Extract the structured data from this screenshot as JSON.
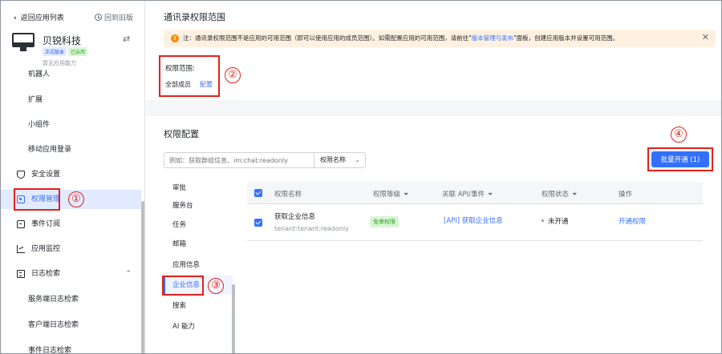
{
  "sidebar": {
    "back_label": "返回应用列表",
    "old_version_label": "回到旧版",
    "app_name": "贝锐科技",
    "badges": [
      "正式版本",
      "已启用"
    ],
    "ability_text": "暂无应用能力",
    "cut_item": "机器人",
    "items": [
      {
        "label": "扩展",
        "level": "sub"
      },
      {
        "label": "小组件",
        "level": "sub"
      },
      {
        "label": "移动应用登录",
        "level": "sub"
      },
      {
        "label": "安全设置",
        "level": "top",
        "icon": "shield-icon"
      },
      {
        "label": "权限管理",
        "level": "top",
        "icon": "key-icon",
        "active": true
      },
      {
        "label": "事件订阅",
        "level": "top",
        "icon": "event-icon"
      },
      {
        "label": "应用监控",
        "level": "top",
        "icon": "chart-icon"
      },
      {
        "label": "日志检索",
        "level": "top",
        "icon": "log-icon",
        "expanded": true
      },
      {
        "label": "服务端日志检索",
        "level": "sub"
      },
      {
        "label": "客户端日志检索",
        "level": "sub"
      },
      {
        "label": "事件日志检索",
        "level": "sub"
      }
    ]
  },
  "scope_section": {
    "title": "通讯录权限范围",
    "notice_prefix": "注：通讯录权限范围不是应用的可用范围（即可以使用应用的成员范围）。如需配置应用的可用范围，请前往\"",
    "notice_link": "版本管理与发布",
    "notice_suffix": "\"面板，创建应用版本并设置可用范围。",
    "scope_label": "权限范围:",
    "scope_value": "全部成员",
    "configure_label": "配置"
  },
  "permission_section": {
    "title": "权限配置",
    "search_placeholder": "例如：获取群组信息、im:chat:readonly",
    "select_value": "权限名称",
    "batch_button": "批量开通 (1)",
    "categories": [
      "审批",
      "服务台",
      "任务",
      "邮箱",
      "应用信息",
      "企业信息",
      "搜索",
      "AI 能力"
    ],
    "active_category": 5,
    "table": {
      "headers": [
        "权限名称",
        "权限等级",
        "关联 API/事件",
        "权限状态",
        "操作"
      ],
      "rows": [
        {
          "name": "获取企业信息",
          "code": "tenant:tenant:readonly",
          "level": "免审权限",
          "api": "[API] 获取企业信息",
          "status": "未开通",
          "action": "开通权限"
        }
      ]
    }
  },
  "annotations": [
    "①",
    "②",
    "③",
    "④"
  ],
  "colors": {
    "accent": "#3370ff",
    "annotation": "#e4201b",
    "notice_bg": "#fff1e1",
    "active_bg": "#e1eaff"
  }
}
